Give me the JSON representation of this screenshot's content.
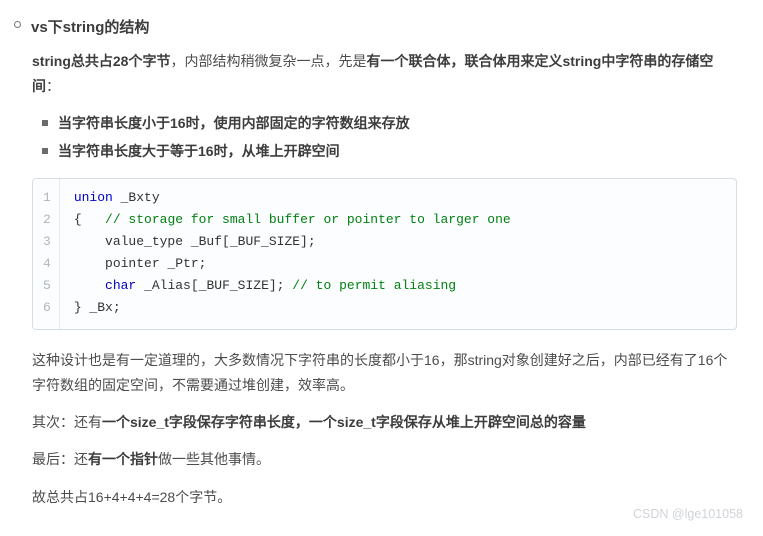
{
  "heading": "vs下string的结构",
  "intro": {
    "strong1": "string总共占28个字节",
    "mid": "，内部结构稍微复杂一点，先是",
    "strong2": "有一个联合体，联合体用来定义string中字符串的存储空间",
    "tail": "："
  },
  "sublist": [
    "当字符串长度小于16时，使用内部固定的字符数组来存放",
    "当字符串长度大于等于16时，从堆上开辟空间"
  ],
  "code": {
    "lines": [
      "1",
      "2",
      "3",
      "4",
      "5",
      "6"
    ],
    "l1_kw": "union",
    "l1_rest": " _Bxty",
    "l2_open": "{   ",
    "l2_cm": "// storage for small buffer or pointer to larger one",
    "l3": "    value_type _Buf[_BUF_SIZE];",
    "l4": "    pointer _Ptr;",
    "l5_pre": "    ",
    "l5_kw": "char",
    "l5_mid": " _Alias[_BUF_SIZE]; ",
    "l5_cm": "// to permit aliasing",
    "l6": "} _Bx;"
  },
  "para2": "这种设计也是有一定道理的，大多数情况下字符串的长度都小于16，那string对象创建好之后，内部已经有了16个字符数组的固定空间，不需要通过堆创建，效率高。",
  "para3": {
    "pre": "其次：还有",
    "strong": "一个size_t字段保存字符串长度，一个size_t字段保存从堆上开辟空间总的容量"
  },
  "para4": {
    "pre": "最后：还",
    "strong": "有一个指针",
    "tail": "做一些其他事情。"
  },
  "para5": "故总共占16+4+4+4=28个字节。",
  "watermark": "CSDN @lge101058"
}
